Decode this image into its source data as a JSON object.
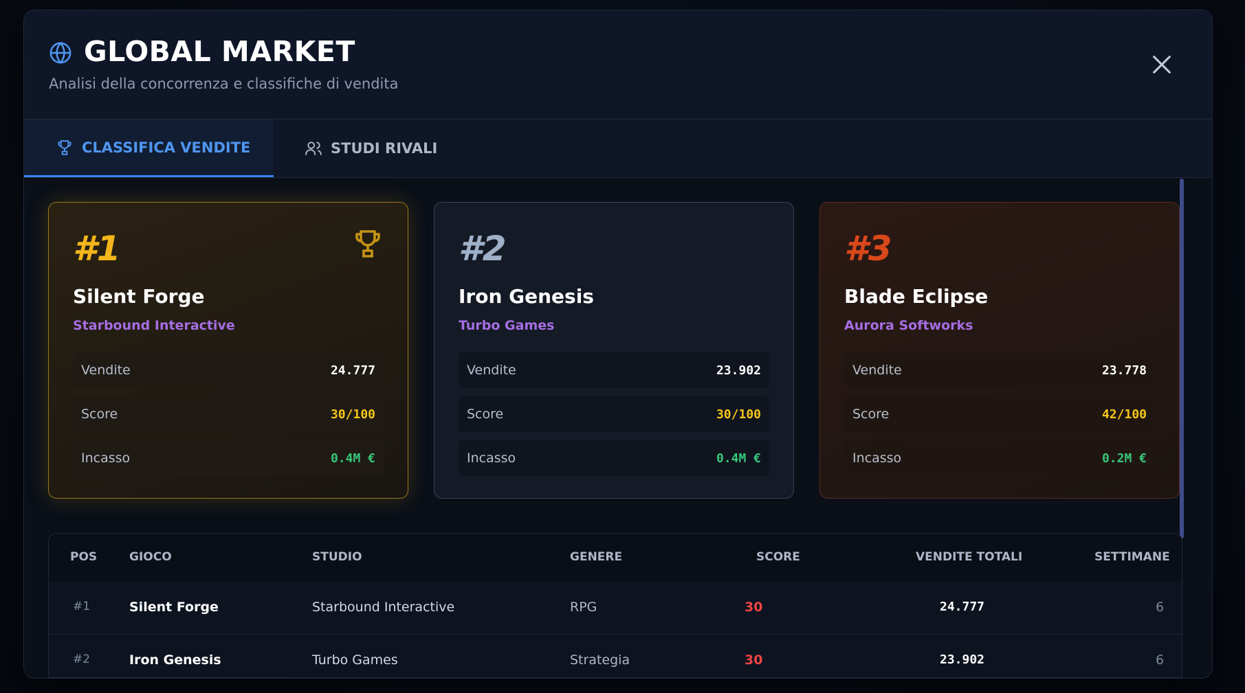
{
  "header": {
    "title": "GLOBAL MARKET",
    "subtitle": "Analisi della concorrenza e classifiche di vendita"
  },
  "tabs": [
    {
      "label": "CLASSIFICA VENDITE",
      "icon": "trophy-icon",
      "active": true
    },
    {
      "label": "STUDI RIVALI",
      "icon": "users-icon",
      "active": false
    }
  ],
  "colors": {
    "accent": "#3b82f6",
    "gold": "#f2b51c",
    "silver": "#9fb0c7",
    "bronze": "#d9481b",
    "studio": "#a66ee3",
    "score": "#f5c61a",
    "income": "#37c67a",
    "table_score": "#ef4444"
  },
  "podium": [
    {
      "rank": "#1",
      "game": "Silent Forge",
      "studio": "Starbound Interactive",
      "stats": [
        {
          "label": "Vendite",
          "value": "24.777"
        },
        {
          "label": "Score",
          "value": "30/100"
        },
        {
          "label": "Incasso",
          "value": "0.4M €"
        }
      ]
    },
    {
      "rank": "#2",
      "game": "Iron Genesis",
      "studio": "Turbo Games",
      "stats": [
        {
          "label": "Vendite",
          "value": "23.902"
        },
        {
          "label": "Score",
          "value": "30/100"
        },
        {
          "label": "Incasso",
          "value": "0.4M €"
        }
      ]
    },
    {
      "rank": "#3",
      "game": "Blade Eclipse",
      "studio": "Aurora Softworks",
      "stats": [
        {
          "label": "Vendite",
          "value": "23.778"
        },
        {
          "label": "Score",
          "value": "42/100"
        },
        {
          "label": "Incasso",
          "value": "0.2M €"
        }
      ]
    }
  ],
  "table": {
    "columns": [
      "POS",
      "GIOCO",
      "STUDIO",
      "GENERE",
      "SCORE",
      "VENDITE TOTALI",
      "SETTIMANE"
    ],
    "rows": [
      {
        "pos": "#1",
        "game": "Silent Forge",
        "studio": "Starbound Interactive",
        "genre": "RPG",
        "score": "30",
        "sales": "24.777",
        "weeks": "6"
      },
      {
        "pos": "#2",
        "game": "Iron Genesis",
        "studio": "Turbo Games",
        "genre": "Strategia",
        "score": "30",
        "sales": "23.902",
        "weeks": "6"
      }
    ]
  }
}
